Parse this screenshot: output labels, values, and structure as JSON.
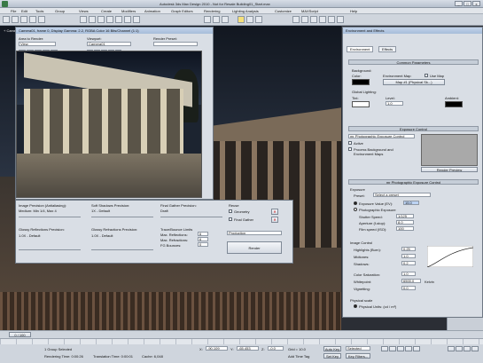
{
  "app": {
    "title": "Autodesk 3ds Max Design 2010    - Not for Resale    Building01_Start.max",
    "window_controls": [
      "_",
      "□",
      "x"
    ]
  },
  "menu": [
    "File",
    "Edit",
    "Tools",
    "Group",
    "Views",
    "Create",
    "Modifiers",
    "Animation",
    "Graph Editors",
    "Rendering",
    "Lighting Analysis",
    "Customize",
    "MAXScript",
    "Help"
  ],
  "viewport": {
    "label": "+ Camera01 | Smooth + Highlights"
  },
  "render_frame": {
    "title": "Camera01, frame 0, Display Gamma: 2.2, RGBA Color 16 Bits/Channel (1:1)",
    "area_to_render_label": "Area to Render:",
    "area_to_render_value": "View",
    "viewport_label": "Viewport:",
    "viewport_value": "Camera01",
    "render_preset_label": "Render Preset:",
    "render_preset_value": "",
    "channel_value": "RGB Alpha"
  },
  "render_params": {
    "image_precision_label": "Image Precision (Antialiasing):",
    "image_precision_value": "Medium: Min 1/4, Max 4",
    "soft_shadows_label": "Soft Shadows Precision:",
    "soft_shadows_value": "1X - Default",
    "final_gather_label": "Final Gather Precision:",
    "final_gather_value": "Draft",
    "reuse_label": "Reuse",
    "geometry_label": "Geometry",
    "final_gather_check_label": "Final Gather",
    "glossy_reflections_label": "Glossy Reflections Precision:",
    "glossy_reflections_value": "1.0X - Default",
    "glossy_refractions_label": "Glossy Refractions Precision:",
    "glossy_refractions_value": "1.0X - Default",
    "trace_bounce_label": "Trace/Bounce Limits",
    "max_reflections_label": "Max. Reflections:",
    "max_reflections_value": "6",
    "max_refractions_label": "Max. Refractions:",
    "max_refractions_value": "6",
    "fg_bounces_label": "FG Bounces:",
    "fg_bounces_value": "0",
    "production_value": "Production",
    "render_button": "Render"
  },
  "environment": {
    "title": "Environment and Effects",
    "tabs": [
      "Environment",
      "Effects"
    ],
    "common_params": "Common Parameters",
    "background_label": "Background:",
    "color_label": "Color:",
    "env_map_label": "Environment Map:",
    "use_map_label": "Use Map",
    "env_map_value": "Map #1 (Physical Sk...)",
    "global_lighting_label": "Global Lighting:",
    "tint_label": "Tint:",
    "level_label": "Level:",
    "level_value": "1.0",
    "ambient_label": "Ambient:",
    "exposure_control": "Exposure Control",
    "exposure_type": "mr Photographic Exposure Control",
    "active_label": "Active",
    "process_bg_label": "Process Background and Environment Maps",
    "render_preview_button": "Render Preview",
    "mr_photo_rollout": "mr Photographic Exposure Control",
    "exposure_label": "Exposure",
    "preset_label": "Preset:",
    "preset_value": "Select a preset",
    "exposure_value_label": "Exposure Value (EV):",
    "exposure_value": "15.0",
    "photographic_exposure_label": "Photographic Exposure",
    "shutter_speed_label": "Shutter Speed:",
    "shutter_speed_value": "1/125",
    "aperture_label": "Aperture (f-stop):",
    "aperture_value": "8.0",
    "film_speed_label": "Film speed (ISO):",
    "film_speed_value": "100",
    "image_control_label": "Image Control",
    "highlights_label": "Highlights (Burn):",
    "highlights_value": "0.25",
    "midtones_label": "Midtones:",
    "midtones_value": "1.0",
    "shadows_label": "Shadows:",
    "shadows_value": "0.2",
    "color_saturation_label": "Color Saturation:",
    "color_saturation_value": "1.0",
    "whitepoint_label": "Whitepoint:",
    "whitepoint_value": "6500.0",
    "whitepoint_unit": "Kelvin",
    "vignetting_label": "Vignetting:",
    "vignetting_value": "0.0",
    "physical_scale_label": "Physical scale",
    "physical_scale_value": "Physical Units: (cd / m²)"
  },
  "status": {
    "timeline": "0 / 100",
    "selection": "1 Group Selected",
    "rendering_time": "Rendering Time: 0:00:26",
    "translation_time": "Translation Time: 0:00:01",
    "cache": "Cache: 6,048",
    "x_label": "X:",
    "x_value": "-90.109",
    "y_label": "Y:",
    "y_value": "-65.453",
    "z_label": "Z:",
    "z_value": "-0.0",
    "grid": "Grid = 10.0",
    "auto_key": "Auto Key",
    "set_key": "Set Key",
    "selected": "Selected",
    "add_time_tag": "Add Time Tag",
    "key_filters": "Key Filters..."
  }
}
